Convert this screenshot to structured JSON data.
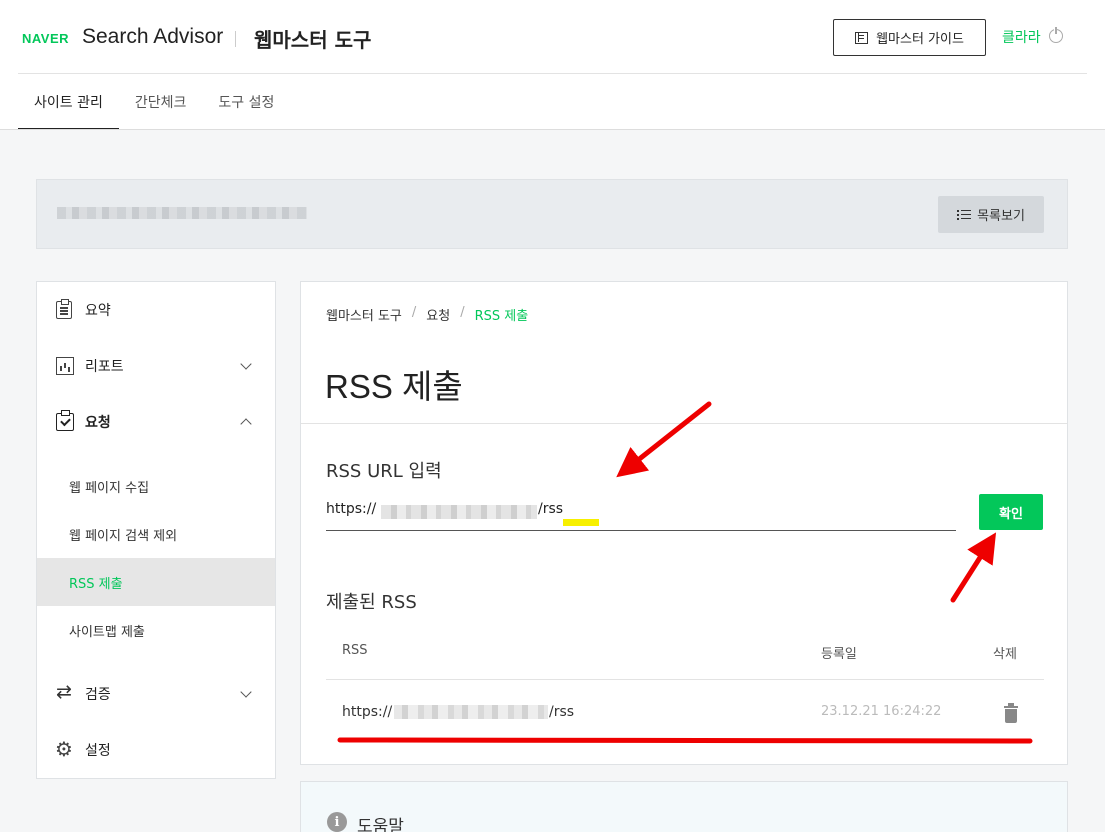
{
  "header": {
    "naver_logo": "NAVER",
    "brand": "Search Advisor",
    "subbrand": "웹마스터 도구",
    "guide_button": "웹마스터 가이드",
    "user_name": "클라라"
  },
  "tabs": [
    {
      "label": "사이트 관리",
      "active": true
    },
    {
      "label": "간단체크",
      "active": false
    },
    {
      "label": "도구 설정",
      "active": false
    }
  ],
  "sitebar": {
    "list_button": "목록보기"
  },
  "sidebar": {
    "items": [
      {
        "label": "요약",
        "icon": "clipboard-icon"
      },
      {
        "label": "리포트",
        "icon": "chart-icon",
        "expanded": false
      },
      {
        "label": "요청",
        "icon": "clipboard-check-icon",
        "expanded": true
      },
      {
        "label": "검증",
        "icon": "repeat-icon",
        "expanded": false
      },
      {
        "label": "설정",
        "icon": "gear-icon"
      }
    ],
    "sub_items": [
      {
        "label": "웹 페이지 수집",
        "active": false
      },
      {
        "label": "웹 페이지 검색 제외",
        "active": false
      },
      {
        "label": "RSS 제출",
        "active": true
      },
      {
        "label": "사이트맵 제출",
        "active": false
      }
    ]
  },
  "main": {
    "breadcrumb": [
      "웹마스터 도구",
      "요청",
      "RSS 제출"
    ],
    "title": "RSS 제출",
    "input_label": "RSS URL 입력",
    "input_prefix": "https://",
    "input_suffix": "/rss",
    "confirm_button": "확인",
    "submitted_label": "제출된 RSS",
    "table": {
      "headers": [
        "RSS",
        "등록일",
        "삭제"
      ],
      "rows": [
        {
          "url_prefix": "https://",
          "url_suffix": "/rss",
          "date": "23.12.21 16:24:22"
        }
      ]
    }
  },
  "help": {
    "label": "도움말"
  },
  "colors": {
    "accent": "#03c75a",
    "annotation": "#ee0000",
    "highlight": "#f7f000"
  }
}
